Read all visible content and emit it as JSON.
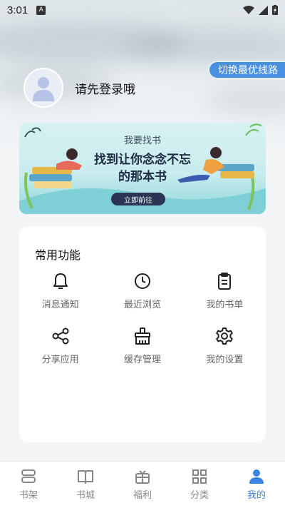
{
  "status_bar": {
    "time": "3:01",
    "notification_badge": "A"
  },
  "route_button": {
    "label": "切换最优线路"
  },
  "profile": {
    "login_prompt": "请先登录哦"
  },
  "banner": {
    "title": "我要找书",
    "headline_line1": "找到让你念念不忘",
    "headline_line2": "的那本书",
    "cta": "立即前往"
  },
  "functions": {
    "title": "常用功能",
    "items": [
      {
        "label": "消息通知",
        "icon": "bell-icon"
      },
      {
        "label": "最近浏览",
        "icon": "clock-icon"
      },
      {
        "label": "我的书单",
        "icon": "clipboard-icon"
      },
      {
        "label": "分享应用",
        "icon": "share-icon"
      },
      {
        "label": "缓存管理",
        "icon": "broom-icon"
      },
      {
        "label": "我的设置",
        "icon": "gear-icon"
      }
    ]
  },
  "tabs": [
    {
      "label": "书架",
      "icon": "bookshelf-icon",
      "active": false
    },
    {
      "label": "书城",
      "icon": "open-book-icon",
      "active": false
    },
    {
      "label": "福利",
      "icon": "gift-icon",
      "active": false
    },
    {
      "label": "分类",
      "icon": "grid-icon",
      "active": false
    },
    {
      "label": "我的",
      "icon": "person-icon",
      "active": true
    }
  ],
  "colors": {
    "accent": "#3a86e0",
    "route_button": "#4a90e2",
    "banner_button": "#2a3555"
  }
}
